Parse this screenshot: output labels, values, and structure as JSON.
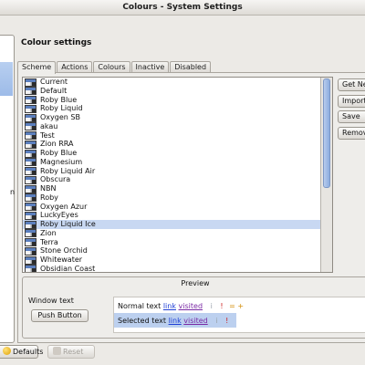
{
  "window": {
    "title": "Colours - System Settings"
  },
  "sidebar": {
    "cut_text": "n"
  },
  "page": {
    "title": "Colour settings"
  },
  "tabs": [
    "Scheme",
    "Actions",
    "Colours",
    "Inactive",
    "Disabled"
  ],
  "schemes": [
    "Current",
    "Default",
    "Roby Blue",
    "Roby Liquid",
    "Oxygen SB",
    "akau",
    "Test",
    "Zion RRA",
    "Roby Blue",
    "Magnesium",
    "Roby Liquid Air",
    "Obscura",
    "NBN",
    "Roby",
    "Oxygen Azur",
    "LuckyEyes",
    "Roby Liquid Ice",
    "Zion",
    "Terra",
    "Stone Orchid",
    "Whitewater",
    "Obsidian Coast"
  ],
  "selected_scheme": "Roby Liquid Ice",
  "side_buttons": [
    "Get New",
    "Import",
    "Save",
    "Remove"
  ],
  "preview": {
    "title": "Preview",
    "window_text_label": "Window text",
    "push_button_label": "Push Button",
    "normal_text": "Normal text",
    "selected_text": "Selected text",
    "link": "link",
    "visited": "visited",
    "neg_mark": "i",
    "neutral_mark": "!",
    "inactive_mark": "i",
    "pos_marks": "= +"
  },
  "bottom": {
    "defaults_label": "Defaults",
    "reset_label": "Reset"
  },
  "colors": {
    "selection": "#c8d8f2",
    "link": "#1f3fd6",
    "visited": "#7a2aa5"
  }
}
